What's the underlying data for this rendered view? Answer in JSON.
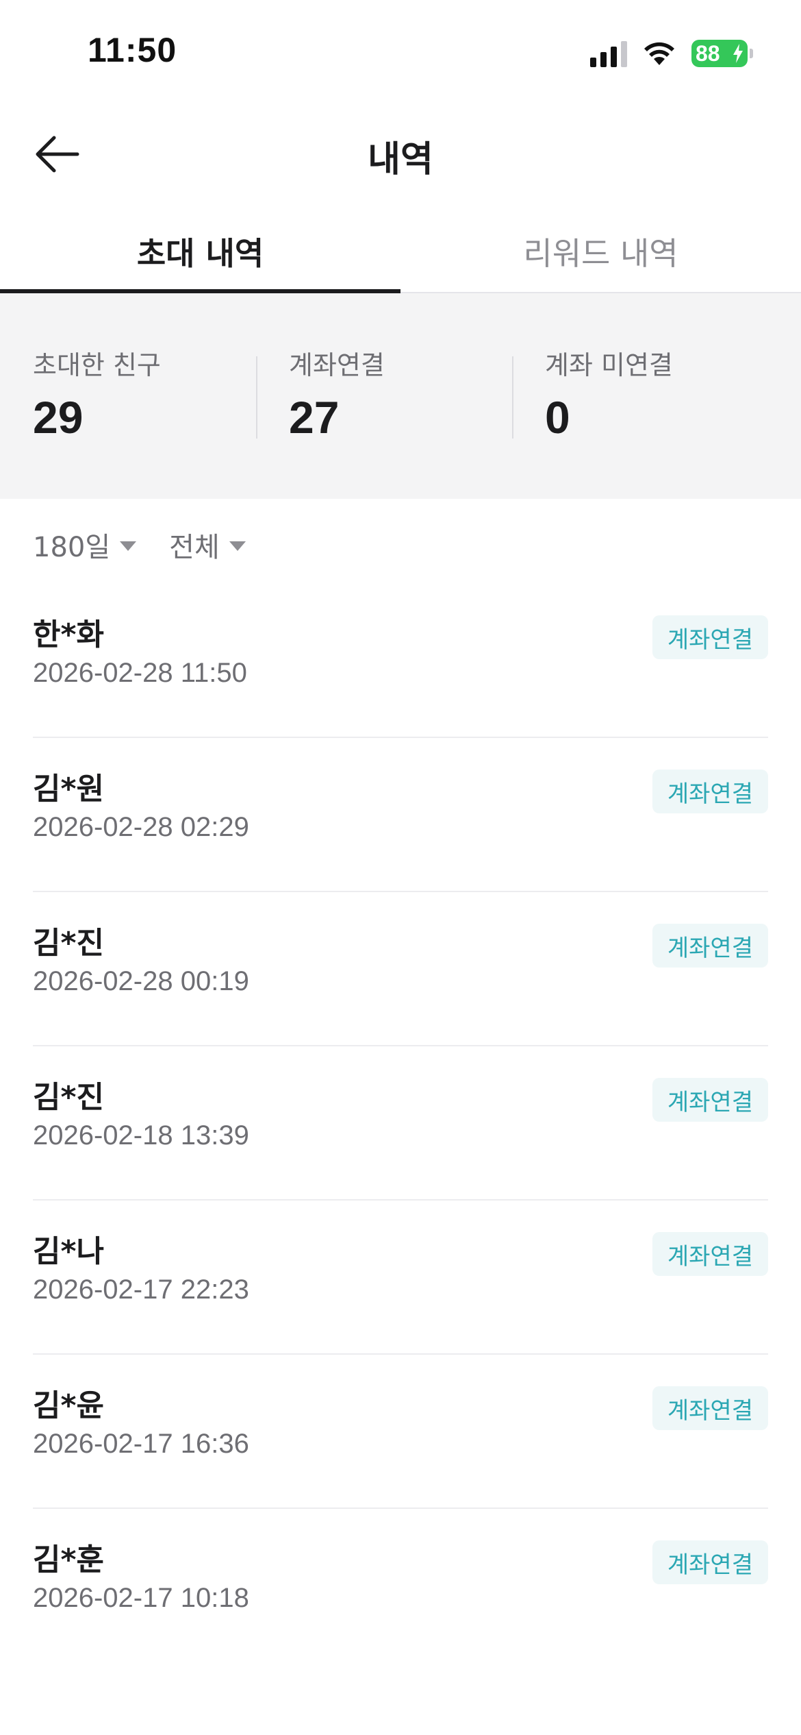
{
  "status_bar": {
    "time": "11:50",
    "battery": "88"
  },
  "header": {
    "title": "내역"
  },
  "tabs": [
    {
      "label": "초대 내역",
      "active": true
    },
    {
      "label": "리워드 내역",
      "active": false
    }
  ],
  "summary": {
    "invited": {
      "label": "초대한 친구",
      "value": "29"
    },
    "linked": {
      "label": "계좌연결",
      "value": "27"
    },
    "unlinked": {
      "label": "계좌 미연결",
      "value": "0"
    }
  },
  "filters": {
    "period": "180일",
    "type": "전체"
  },
  "list": [
    {
      "name": "한*화",
      "datetime": "2026-02-28 11:50",
      "status": "계좌연결"
    },
    {
      "name": "김*원",
      "datetime": "2026-02-28 02:29",
      "status": "계좌연결"
    },
    {
      "name": "김*진",
      "datetime": "2026-02-28 00:19",
      "status": "계좌연결"
    },
    {
      "name": "김*진",
      "datetime": "2026-02-18 13:39",
      "status": "계좌연결"
    },
    {
      "name": "김*나",
      "datetime": "2026-02-17 22:23",
      "status": "계좌연결"
    },
    {
      "name": "김*윤",
      "datetime": "2026-02-17 16:36",
      "status": "계좌연결"
    },
    {
      "name": "김*훈",
      "datetime": "2026-02-17 10:18",
      "status": "계좌연결"
    }
  ],
  "colors": {
    "accent": "#2ba7b3",
    "badge_bg": "#eef7f8",
    "battery": "#34c759"
  }
}
